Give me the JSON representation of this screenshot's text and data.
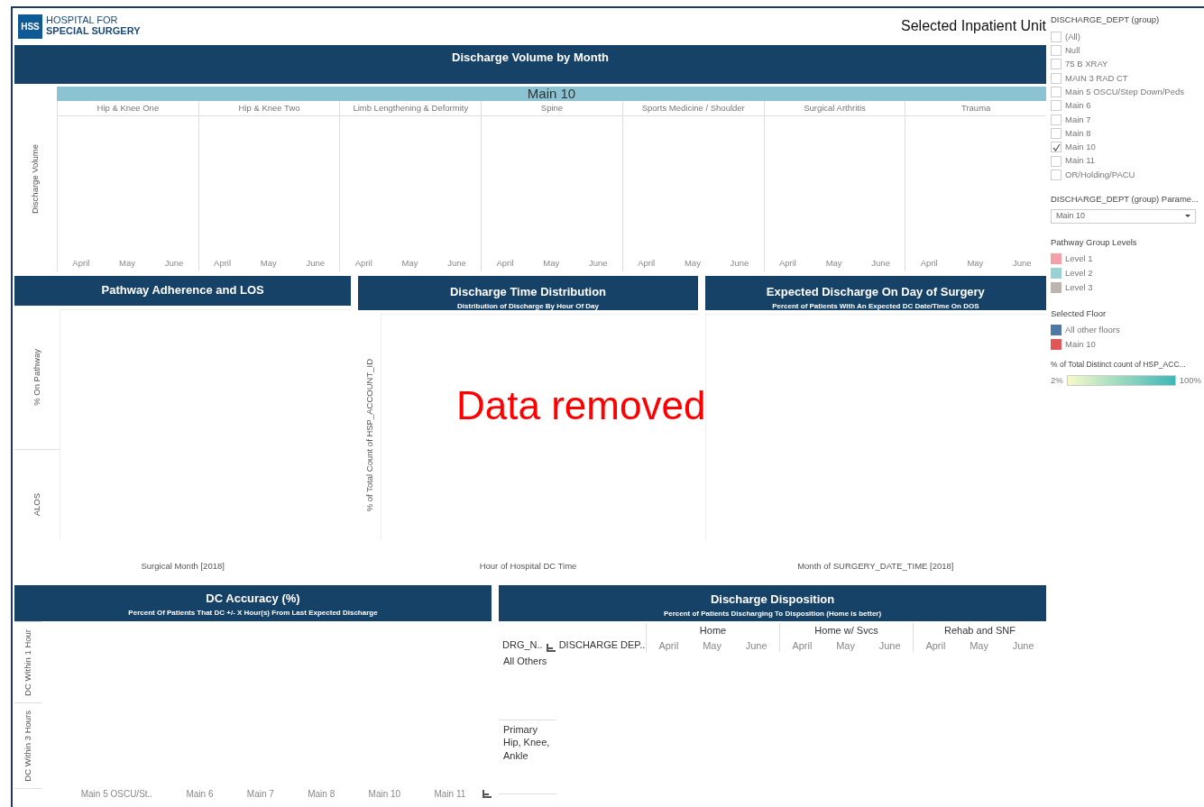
{
  "header": {
    "logo_mark": "HSS",
    "logo_line1": "HOSPITAL FOR",
    "logo_line2": "SPECIAL SURGERY",
    "title": "Selected Inpatient Unit"
  },
  "volume": {
    "title": "Discharge Volume by  Month",
    "y_axis": "Discharge Volume",
    "unit": "Main 10",
    "facets": [
      {
        "name": "Hip & Knee One",
        "months": [
          "April",
          "May",
          "June"
        ]
      },
      {
        "name": "Hip & Knee Two",
        "months": [
          "April",
          "May",
          "June"
        ]
      },
      {
        "name": "Limb Lengthening & Deformity",
        "months": [
          "April",
          "May",
          "June"
        ]
      },
      {
        "name": "Spine",
        "months": [
          "April",
          "May",
          "June"
        ]
      },
      {
        "name": "Sports Medicine / Shoulder",
        "months": [
          "April",
          "May",
          "June"
        ]
      },
      {
        "name": "Surgical Arthritis",
        "months": [
          "April",
          "May",
          "June"
        ]
      },
      {
        "name": "Trauma",
        "months": [
          "April",
          "May",
          "June"
        ]
      }
    ]
  },
  "middle": [
    {
      "title": "Pathway Adherence and  LOS",
      "y_axes": [
        "% On Pathway",
        "ALOS"
      ],
      "x_axis": "Surgical Month  [2018]"
    },
    {
      "title": "Discharge Time Distribution",
      "subtitle": "Distribution of Discharge By Hour Of Day",
      "y_axes": [
        "% of Total Count of HSP_ACCOUNT_ID"
      ],
      "x_axis": "Hour of Hospital DC Time"
    },
    {
      "title": "Expected Discharge On Day of Surgery",
      "subtitle": "Percent of Patients With An Expected DC Date/Time On DOS",
      "x_axis": "Month of SURGERY_DATE_TIME [2018]"
    }
  ],
  "overlay": "Data removed",
  "accuracy": {
    "title": "DC Accuracy (%)",
    "subtitle": "Percent Of Patients That DC +/- X Hour(s) From Last Expected Discharge",
    "rows": [
      "DC Within 1 Hour",
      "DC Within 3 Hours"
    ],
    "categories": [
      "Main 5 OSCU/St..",
      "Main 6",
      "Main 7",
      "Main 8",
      "Main 10",
      "Main 11"
    ]
  },
  "disposition": {
    "title": "Discharge Disposition",
    "subtitle": "Percent of Patients Discharging To Disposition (Home is better)",
    "columns": [
      "DRG_N..",
      "DISCHARGE  DEP.."
    ],
    "groups": [
      {
        "name": "Home",
        "months": [
          "April",
          "May",
          "June"
        ]
      },
      {
        "name": "Home w/ Svcs",
        "months": [
          "April",
          "May",
          "June"
        ]
      },
      {
        "name": "Rehab and SNF",
        "months": [
          "April",
          "May",
          "June"
        ]
      }
    ],
    "rows": [
      "All Others",
      "Primary Hip, Knee, Ankle"
    ]
  },
  "filter": {
    "title": "DISCHARGE_DEPT (group)",
    "items": [
      {
        "label": "(All)",
        "checked": false
      },
      {
        "label": "Null",
        "checked": false
      },
      {
        "label": "75 B XRAY",
        "checked": false
      },
      {
        "label": "MAIN 3 RAD CT",
        "checked": false
      },
      {
        "label": "Main 5 OSCU/Step Down/Peds",
        "checked": false
      },
      {
        "label": "Main 6",
        "checked": false
      },
      {
        "label": "Main 7",
        "checked": false
      },
      {
        "label": "Main 8",
        "checked": false
      },
      {
        "label": "Main 10",
        "checked": true
      },
      {
        "label": "Main 11",
        "checked": false
      },
      {
        "label": "OR/Holding/PACU",
        "checked": false
      }
    ]
  },
  "parameter": {
    "title": "DISCHARGE_DEPT (group) Parame...",
    "value": "Main 10"
  },
  "legends": [
    {
      "title": "Pathway Group Levels",
      "items": [
        {
          "label": "Level 1",
          "color": "#f4a0a8"
        },
        {
          "label": "Level 2",
          "color": "#99d2d2"
        },
        {
          "label": "Level 3",
          "color": "#bdb4b0"
        }
      ]
    },
    {
      "title": "Selected Floor",
      "items": [
        {
          "label": "All other floors",
          "color": "#4e79a7"
        },
        {
          "label": "Main 10",
          "color": "#e15759"
        }
      ]
    }
  ],
  "gradient": {
    "title": "% of Total Distinct count of HSP_ACC...",
    "min": "2%",
    "max": "100%"
  }
}
